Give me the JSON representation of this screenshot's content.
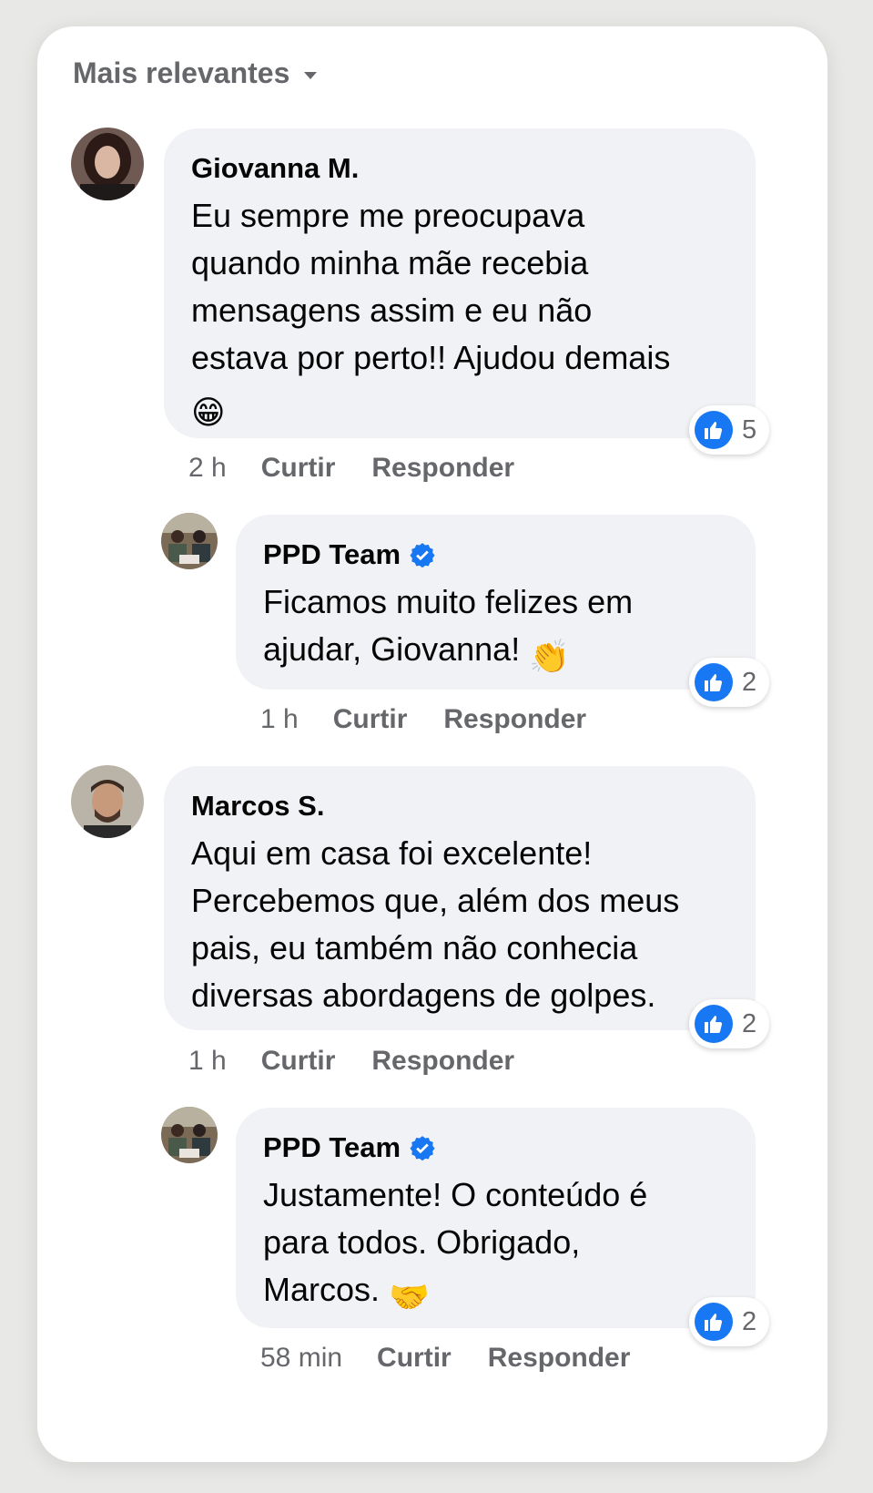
{
  "sort": {
    "label": "Mais relevantes"
  },
  "actions": {
    "like": "Curtir",
    "reply": "Responder"
  },
  "colors": {
    "accent": "#1877f2",
    "bubble": "#f0f2f5",
    "muted": "#65676b"
  },
  "comments": [
    {
      "author": "Giovanna M.",
      "lines": [
        "Eu sempre me preocupava",
        "quando minha mãe recebia",
        "mensagens assim e eu não",
        "estava por perto!! Ajudou demais"
      ],
      "emoji": "😁",
      "emoji_icon": "grinning-face-icon",
      "reactions": "5",
      "time": "2 h"
    },
    {
      "author": "PPD Team",
      "verified": true,
      "lines": [
        "Ficamos muito felizes em",
        "ajudar, Giovanna!"
      ],
      "emoji": "👏",
      "emoji_icon": "clapping-hands-icon",
      "reactions": "2",
      "time": "1 h"
    },
    {
      "author": "Marcos S.",
      "lines": [
        "Aqui em casa foi excelente!",
        "Percebemos que, além dos meus",
        "pais, eu também não conhecia",
        "diversas abordagens de golpes."
      ],
      "reactions": "2",
      "time": "1 h"
    },
    {
      "author": "PPD Team",
      "verified": true,
      "lines": [
        "Justamente! O conteúdo é",
        "para todos. Obrigado,",
        "Marcos."
      ],
      "emoji": "🤝",
      "emoji_icon": "handshake-icon",
      "reactions": "2",
      "time": "58 min"
    }
  ]
}
